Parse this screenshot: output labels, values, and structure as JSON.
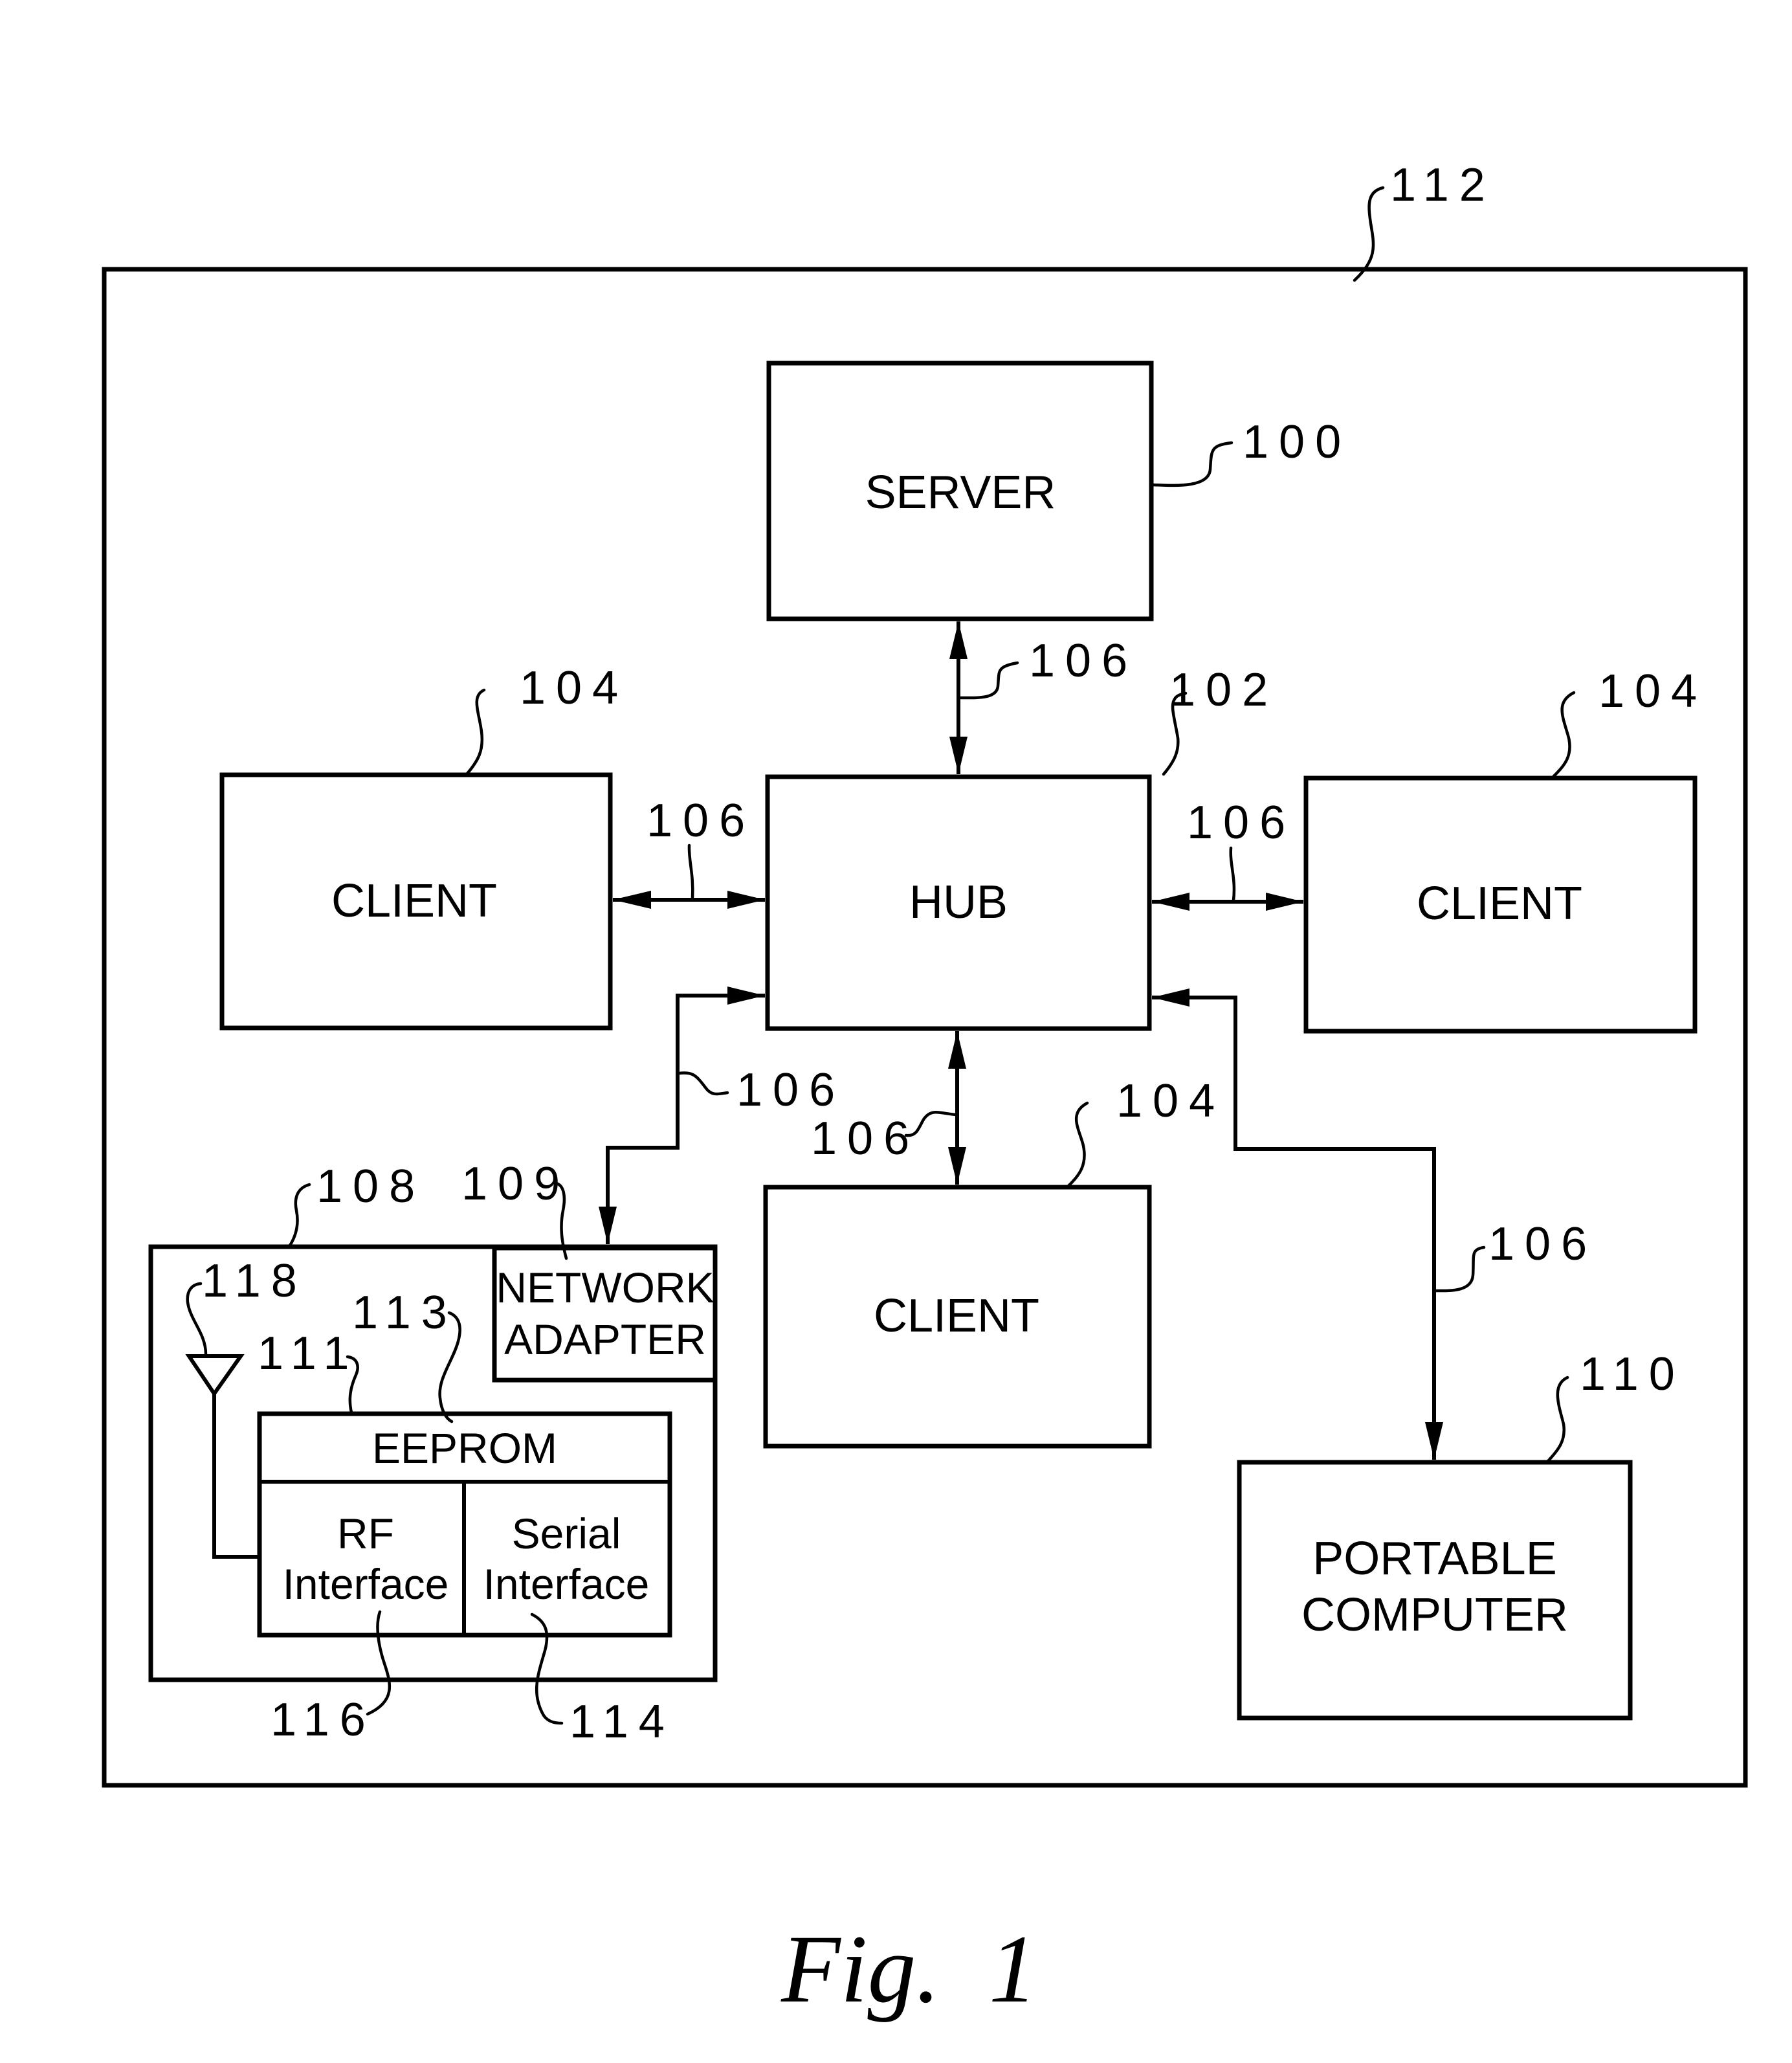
{
  "figure": {
    "caption": "Fig.  1"
  },
  "system": {
    "ref": "112"
  },
  "server": {
    "label": "SERVER",
    "ref": "100"
  },
  "hub": {
    "label": "HUB",
    "ref": "102"
  },
  "clients": [
    {
      "label": "CLIENT",
      "ref": "104"
    },
    {
      "label": "CLIENT",
      "ref": "104"
    },
    {
      "label": "CLIENT",
      "ref": "104"
    }
  ],
  "links": {
    "ref": "106",
    "labels": [
      "106",
      "106",
      "106",
      "106",
      "106",
      "106"
    ]
  },
  "device": {
    "ref": "108",
    "network_adapter": {
      "line1": "NETWORK",
      "line2": "ADAPTER",
      "ref": "109"
    },
    "eeprom": {
      "label": "EEPROM",
      "ref": "113"
    },
    "module_ref": "111",
    "rf_interface": {
      "line1": "RF",
      "line2": "Interface",
      "ref": "116"
    },
    "serial_interface": {
      "line1": "Serial",
      "line2": "Interface",
      "ref": "114"
    },
    "antenna_ref": "118"
  },
  "portable": {
    "line1": "PORTABLE",
    "line2": "COMPUTER",
    "ref": "110"
  }
}
